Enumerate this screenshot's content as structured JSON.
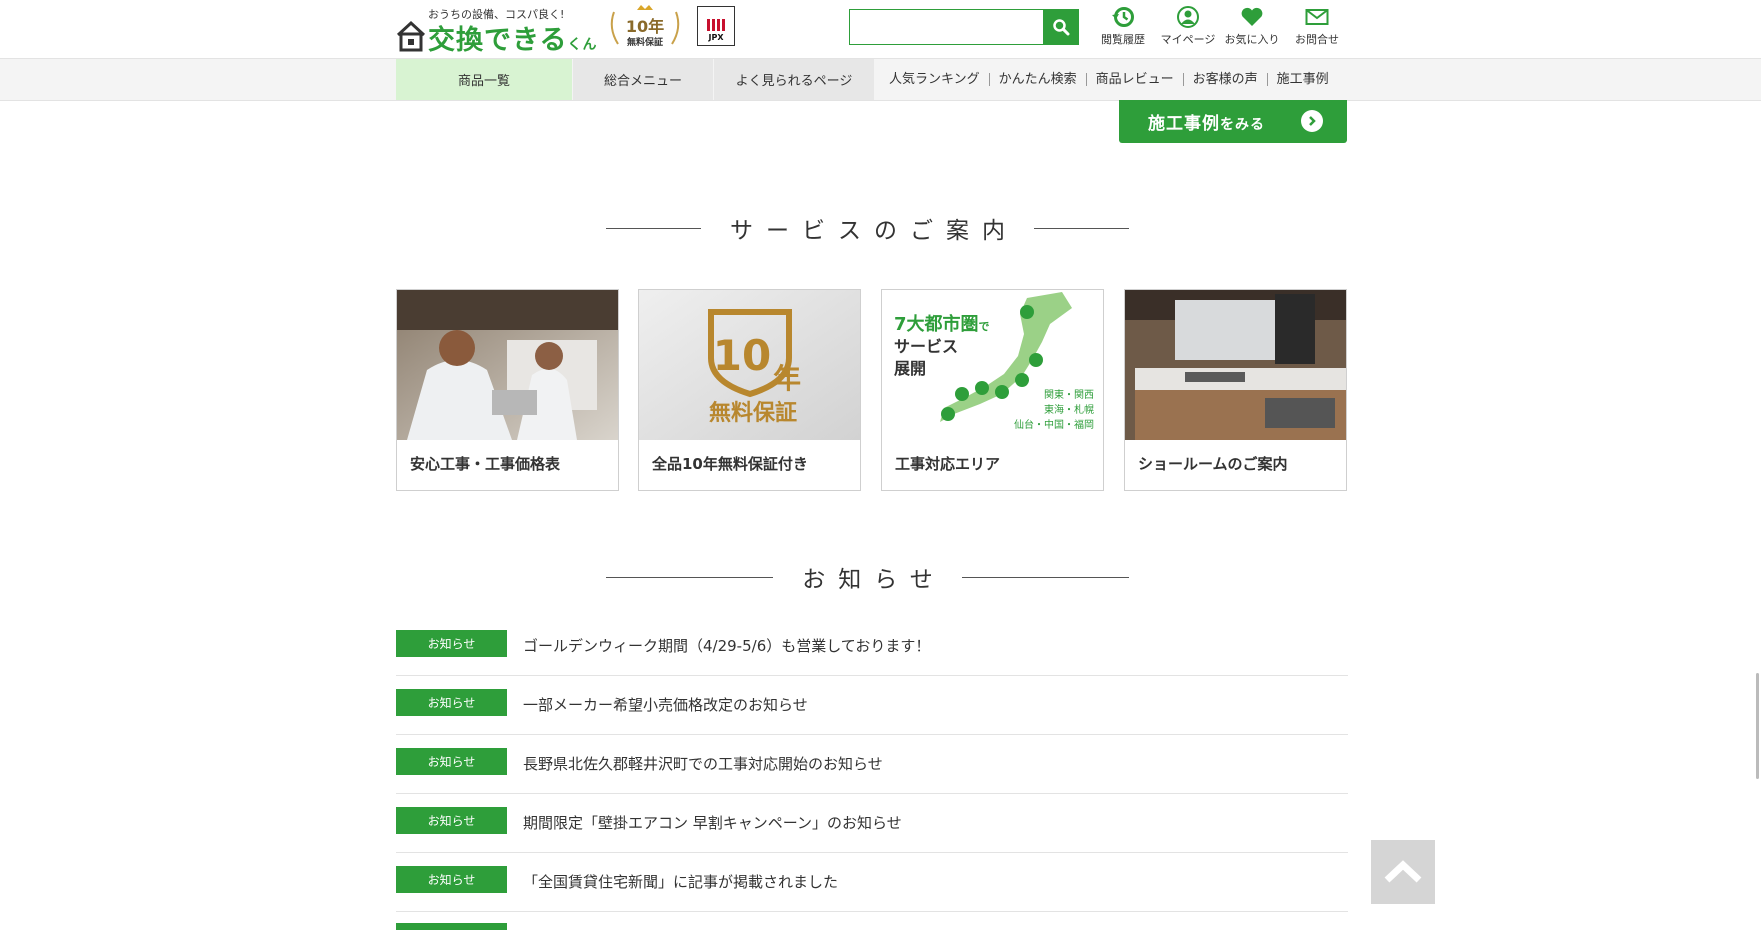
{
  "header": {
    "tagline": "おうちの設備、コスパ良く!",
    "logo_name": "交換できる",
    "logo_suffix": "くん",
    "badge_years": "10年",
    "badge_text": "無料保証",
    "jpx_label": "JPX",
    "search_placeholder": "",
    "icons": [
      {
        "label": "閲覧履歴",
        "icon": "history-icon"
      },
      {
        "label": "マイページ",
        "icon": "user-icon"
      },
      {
        "label": "お気に入り",
        "icon": "heart-icon"
      },
      {
        "label": "お問合せ",
        "icon": "mail-icon"
      }
    ]
  },
  "nav": {
    "tabs": [
      "商品一覧",
      "総合メニュー",
      "よく見られるページ"
    ],
    "links": [
      "人気ランキング",
      "かんたん検索",
      "商品レビュー",
      "お客様の声",
      "施工事例"
    ]
  },
  "cta": {
    "main": "施工事例",
    "suffix": "をみる"
  },
  "services": {
    "title": "サービスのご案内",
    "cards": [
      {
        "label": "安心工事・工事価格表"
      },
      {
        "label": "全品10年無料保証付き",
        "img_big": "10",
        "img_year": "年",
        "img_sub": "無料保証"
      },
      {
        "label": "工事対応エリア",
        "img_head1": "7大都市圏",
        "img_head1b": "で",
        "img_head2": "サービス",
        "img_head3": "展開",
        "img_areas": [
          "関東・関西",
          "東海・札幌",
          "仙台・中国・福岡"
        ]
      },
      {
        "label": "ショールームのご案内"
      }
    ]
  },
  "news": {
    "title": "お知らせ",
    "items": [
      {
        "tag": "お知らせ",
        "title": "ゴールデンウィーク期間（4/29-5/6）も営業しております！"
      },
      {
        "tag": "お知らせ",
        "title": "一部メーカー希望小売価格改定のお知らせ"
      },
      {
        "tag": "お知らせ",
        "title": "長野県北佐久郡軽井沢町での工事対応開始のお知らせ"
      },
      {
        "tag": "お知らせ",
        "title": "期間限定「壁掛エアコン 早割キャンペーン」のお知らせ"
      },
      {
        "tag": "お知らせ",
        "title": "「全国賃貸住宅新聞」に記事が掲載されました"
      }
    ]
  },
  "colors": {
    "brand_green": "#2e9e3a",
    "nav_active": "#d8f3d2",
    "gold": "#b8872e"
  }
}
